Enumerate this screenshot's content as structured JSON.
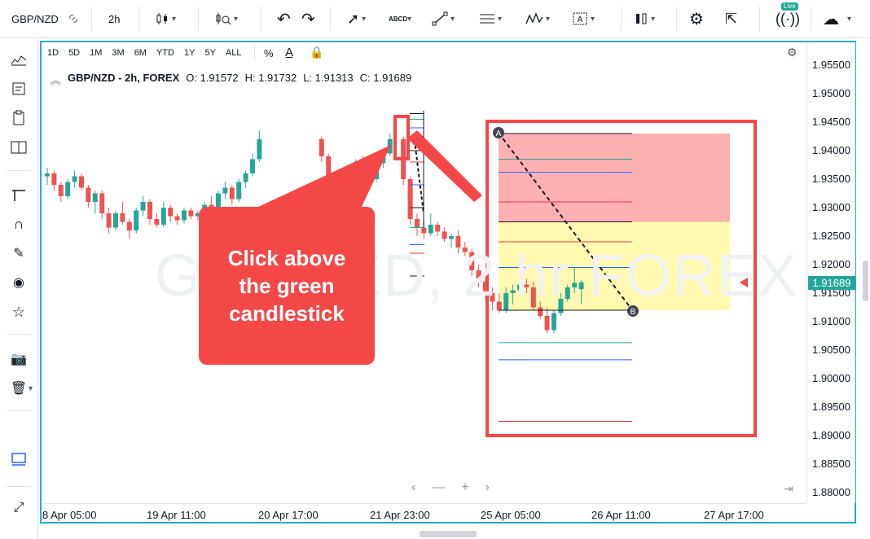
{
  "toolbar": {
    "symbol": "GBP/NZD",
    "interval": "2h",
    "live_badge": "Live",
    "drawing_text_tool": "ABCD"
  },
  "range_bar": [
    "1D",
    "5D",
    "1M",
    "3M",
    "6M",
    "YTD",
    "1Y",
    "5Y",
    "ALL"
  ],
  "legend": {
    "title": "GBP/NZD - 2h, FOREX",
    "o": "O: 1.91572",
    "h": "H: 1.91732",
    "l": "L: 1.91313",
    "c": "C: 1.91689"
  },
  "watermark": "GBP/NZD, 2 hr FOREX",
  "price_axis": [
    "1.95500",
    "1.95000",
    "1.94500",
    "1.94000",
    "1.93500",
    "1.93000",
    "1.92500",
    "1.92000",
    "1.91500",
    "1.91000",
    "1.90500",
    "1.90000",
    "1.89500",
    "1.89000",
    "1.88500",
    "1.88000"
  ],
  "current_price": "1.91689",
  "time_axis": [
    "8 Apr 05:00",
    "19 Apr 11:00",
    "20 Apr 17:00",
    "21 Apr 23:00",
    "25 Apr 05:00",
    "26 Apr 11:00",
    "27 Apr 17:00"
  ],
  "callout": {
    "line1": "Click above",
    "line2": "the green",
    "line3": "candlestick"
  },
  "markers": {
    "a": "A",
    "b": "B"
  },
  "colors": {
    "up": "#26a69a",
    "down": "#ef5350",
    "highlight": "#f44848",
    "frame": "#2ea5d8"
  },
  "chart_data": {
    "type": "candlestick",
    "ylim": [
      1.88,
      1.955
    ],
    "candles": [
      [
        1.9355,
        1.937,
        1.934,
        1.936
      ],
      [
        1.936,
        1.9365,
        1.933,
        1.934
      ],
      [
        1.934,
        1.9345,
        1.931,
        1.932
      ],
      [
        1.932,
        1.935,
        1.9315,
        1.9345
      ],
      [
        1.9345,
        1.9365,
        1.9335,
        1.9355
      ],
      [
        1.9355,
        1.936,
        1.933,
        1.9335
      ],
      [
        1.9335,
        1.934,
        1.93,
        1.931
      ],
      [
        1.931,
        1.933,
        1.929,
        1.9325
      ],
      [
        1.9325,
        1.933,
        1.928,
        1.929
      ],
      [
        1.929,
        1.93,
        1.9255,
        1.9265
      ],
      [
        1.9265,
        1.9295,
        1.926,
        1.929
      ],
      [
        1.929,
        1.931,
        1.927,
        1.9275
      ],
      [
        1.9275,
        1.928,
        1.9245,
        1.926
      ],
      [
        1.926,
        1.93,
        1.9255,
        1.9295
      ],
      [
        1.9295,
        1.932,
        1.9285,
        1.931
      ],
      [
        1.931,
        1.9315,
        1.927,
        1.928
      ],
      [
        1.928,
        1.929,
        1.9265,
        1.927
      ],
      [
        1.927,
        1.931,
        1.9265,
        1.93
      ],
      [
        1.93,
        1.9305,
        1.9275,
        1.9285
      ],
      [
        1.9285,
        1.929,
        1.927,
        1.9278
      ],
      [
        1.9278,
        1.93,
        1.9272,
        1.9295
      ],
      [
        1.9295,
        1.93,
        1.928,
        1.9285
      ],
      [
        1.9285,
        1.9295,
        1.9278,
        1.929
      ],
      [
        1.929,
        1.931,
        1.9285,
        1.9305
      ],
      [
        1.9305,
        1.932,
        1.9295,
        1.93
      ],
      [
        1.93,
        1.933,
        1.9295,
        1.9325
      ],
      [
        1.9325,
        1.9345,
        1.9315,
        1.9335
      ],
      [
        1.9335,
        1.934,
        1.9305,
        1.9315
      ],
      [
        1.9315,
        1.935,
        1.931,
        1.9345
      ],
      [
        1.9345,
        1.9365,
        1.9335,
        1.936
      ],
      [
        1.936,
        1.9395,
        1.9355,
        1.9385
      ],
      [
        1.9385,
        1.9435,
        1.938,
        1.942
      ],
      [
        1.942,
        1.9425,
        1.938,
        1.939
      ],
      [
        1.939,
        1.9395,
        1.933,
        1.934
      ],
      [
        1.934,
        1.9345,
        1.928,
        1.9295
      ],
      [
        1.9295,
        1.933,
        1.9285,
        1.932
      ],
      [
        1.932,
        1.935,
        1.931,
        1.9345
      ],
      [
        1.9345,
        1.9385,
        1.934,
        1.938
      ],
      [
        1.938,
        1.939,
        1.935,
        1.936
      ],
      [
        1.936,
        1.9375,
        1.934,
        1.935
      ],
      [
        1.935,
        1.9385,
        1.9345,
        1.9378
      ],
      [
        1.9378,
        1.94,
        1.937,
        1.9395
      ],
      [
        1.9395,
        1.943,
        1.939,
        1.942
      ],
      [
        1.942,
        1.9425,
        1.934,
        1.935
      ],
      [
        1.935,
        1.9355,
        1.927,
        1.928
      ],
      [
        1.928,
        1.929,
        1.925,
        1.9265
      ],
      [
        1.9265,
        1.9275,
        1.9245,
        1.9255
      ],
      [
        1.9255,
        1.929,
        1.925,
        1.927
      ],
      [
        1.927,
        1.9275,
        1.925,
        1.9258
      ],
      [
        1.9258,
        1.9265,
        1.924,
        1.9245
      ],
      [
        1.9245,
        1.9255,
        1.923,
        1.925
      ],
      [
        1.925,
        1.926,
        1.922,
        1.923
      ],
      [
        1.923,
        1.924,
        1.9215,
        1.9222
      ],
      [
        1.9222,
        1.9228,
        1.918,
        1.919
      ],
      [
        1.919,
        1.92,
        1.916,
        1.917
      ],
      [
        1.917,
        1.918,
        1.914,
        1.915
      ],
      [
        1.915,
        1.916,
        1.912,
        1.9135
      ],
      [
        1.9135,
        1.915,
        1.9115,
        1.912
      ],
      [
        1.912,
        1.916,
        1.9115,
        1.915
      ],
      [
        1.915,
        1.9165,
        1.913,
        1.9155
      ],
      [
        1.9155,
        1.917,
        1.9145,
        1.9165
      ],
      [
        1.9165,
        1.9175,
        1.915,
        1.916
      ],
      [
        1.916,
        1.917,
        1.912,
        1.9125
      ],
      [
        1.9125,
        1.9135,
        1.9105,
        1.911
      ],
      [
        1.911,
        1.9125,
        1.908,
        1.9085
      ],
      [
        1.9085,
        1.912,
        1.908,
        1.9115
      ],
      [
        1.9115,
        1.915,
        1.911,
        1.914
      ],
      [
        1.914,
        1.9165,
        1.9135,
        1.916
      ],
      [
        1.916,
        1.9195,
        1.915,
        1.9168
      ],
      [
        1.9157,
        1.9173,
        1.9131,
        1.9169
      ]
    ],
    "fib_levels": [
      1.943,
      1.9385,
      1.9362,
      1.931,
      1.9275,
      1.924,
      1.9195,
      1.912,
      1.9063,
      1.9033,
      1.8925
    ]
  }
}
